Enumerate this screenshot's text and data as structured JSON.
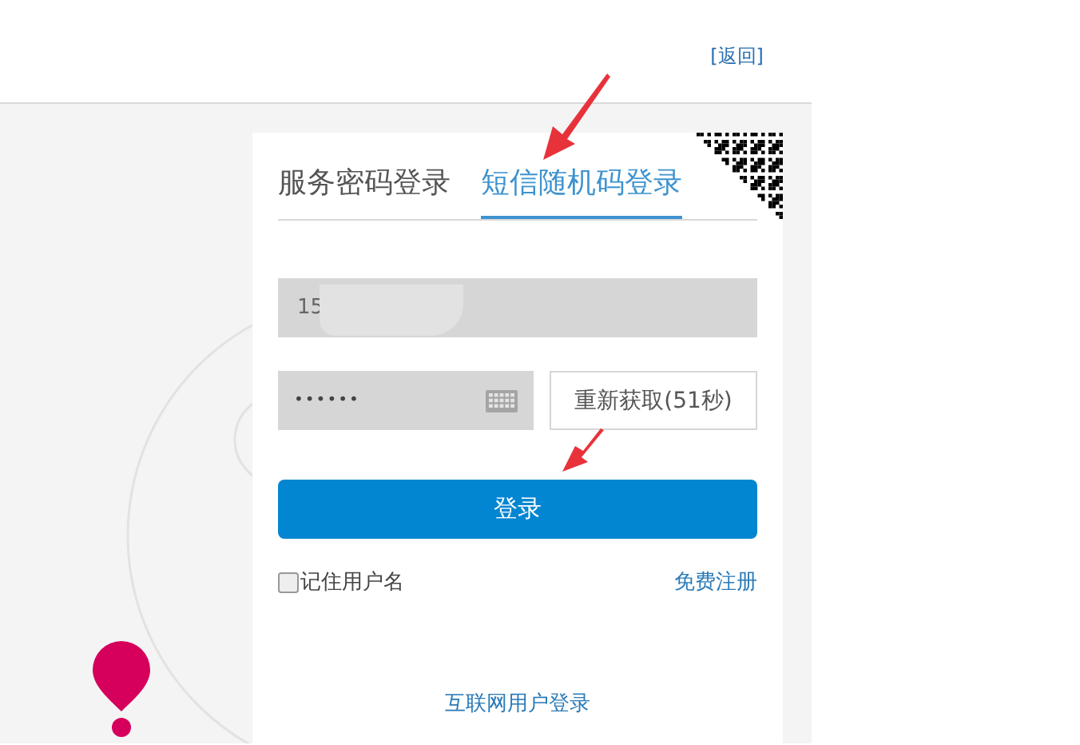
{
  "header": {
    "back_link": "[返回]"
  },
  "tabs": [
    {
      "label": "服务密码登录",
      "selected": false
    },
    {
      "label": "短信随机码登录",
      "selected": true
    }
  ],
  "phone_field": {
    "value": "15"
  },
  "code_field": {
    "value": "••••••"
  },
  "resend_button": "重新获取(51秒)",
  "login_button": "登录",
  "remember": {
    "label": "记住用户名",
    "checked": false
  },
  "register_link": "免费注册",
  "internet_login_link": "互联网用户登录"
}
